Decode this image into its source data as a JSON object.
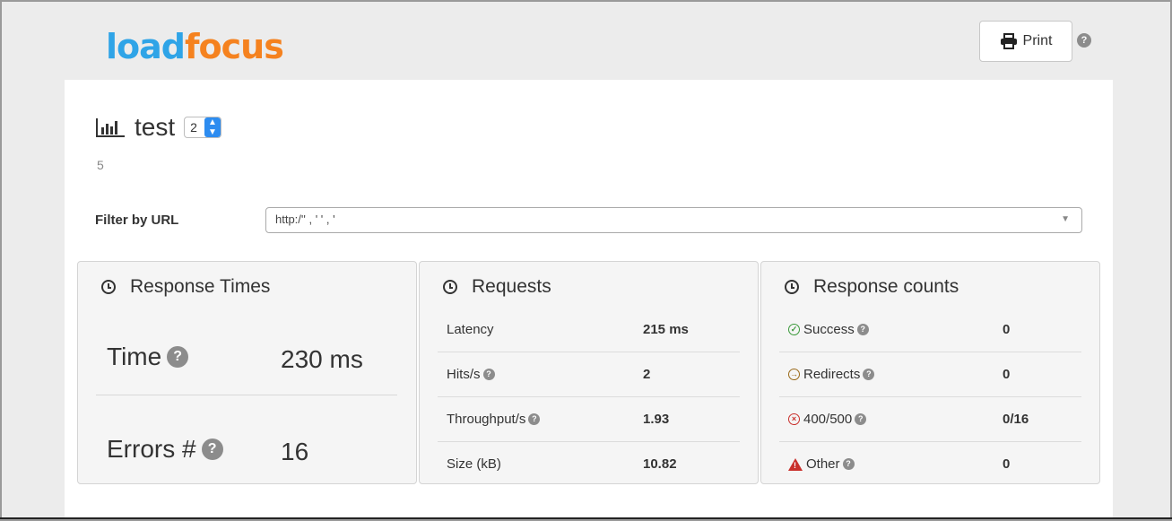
{
  "header": {
    "logo_part1": "load",
    "logo_part2": "focus",
    "print_label": "Print"
  },
  "test": {
    "name": "test",
    "run_selected": "2",
    "subtitle": "5"
  },
  "filter": {
    "label": "Filter by URL",
    "url_value": "http:/'' ,  ' '  ,  '"
  },
  "response_times": {
    "title": "Response Times",
    "time_label": "Time",
    "time_value": "230 ms",
    "errors_label": "Errors #",
    "errors_value": "16"
  },
  "requests": {
    "title": "Requests",
    "rows": [
      {
        "label": "Latency",
        "value": "215 ms"
      },
      {
        "label": "Hits/s",
        "value": "2"
      },
      {
        "label": "Throughput/s",
        "value": "1.93"
      },
      {
        "label": "Size (kB)",
        "value": "10.82"
      }
    ]
  },
  "response_counts": {
    "title": "Response counts",
    "rows": [
      {
        "label": "Success",
        "value": "0",
        "icon": "check-circle-icon",
        "color": "#3c9a3c"
      },
      {
        "label": "Redirects",
        "value": "0",
        "icon": "arrow-circle-icon",
        "color": "#9a6a1a"
      },
      {
        "label": "400/500",
        "value": "0/16",
        "icon": "x-circle-icon",
        "color": "#c9302c"
      },
      {
        "label": "Other",
        "value": "0",
        "icon": "warning-icon",
        "color": "#c9302c"
      }
    ]
  },
  "colors": {
    "logo_blue": "#2fa4e7",
    "logo_orange": "#f5821f",
    "select_blue": "#2d8cf0"
  }
}
